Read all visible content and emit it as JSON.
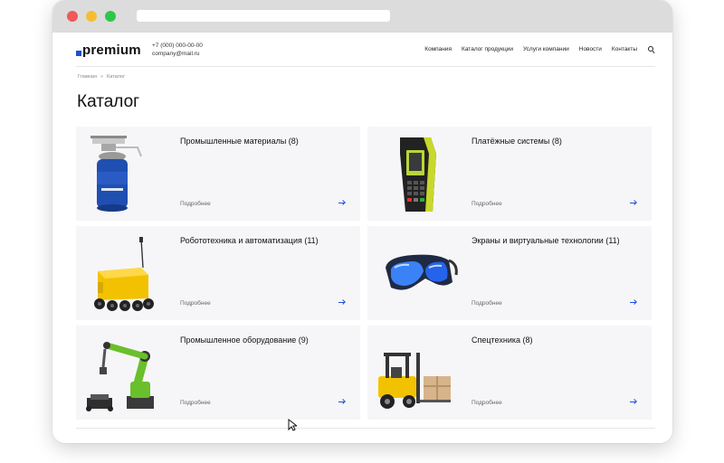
{
  "header": {
    "logo_text": "premium",
    "phone": "+7 (000) 000-00-00",
    "email": "company@mail.ru",
    "nav": [
      "Компания",
      "Каталог продукции",
      "Услуги компании",
      "Новости",
      "Контакты"
    ],
    "search_icon": "search-icon"
  },
  "breadcrumb": {
    "home": "Главная",
    "separator": "»",
    "current": "Каталог"
  },
  "page_title": "Каталог",
  "cards": [
    {
      "name": "Промышленные материалы (8)",
      "more": "Подробнее",
      "image": "gas-canister-burner"
    },
    {
      "name": "Платёжные системы (8)",
      "more": "Подробнее",
      "image": "payment-terminal"
    },
    {
      "name": "Робототехника и автоматизация (11)",
      "more": "Подробнее",
      "image": "delivery-robot"
    },
    {
      "name": "Экраны и виртуальные технологии (11)",
      "more": "Подробнее",
      "image": "vr-goggles"
    },
    {
      "name": "Промышленное оборудование (9)",
      "more": "Подробнее",
      "image": "robotic-arm"
    },
    {
      "name": "Спецтехника (8)",
      "more": "Подробнее",
      "image": "forklift"
    }
  ],
  "colors": {
    "accent": "#1d4ed8",
    "card_bg": "#f6f6f8",
    "chrome": "#dcdcdc"
  }
}
